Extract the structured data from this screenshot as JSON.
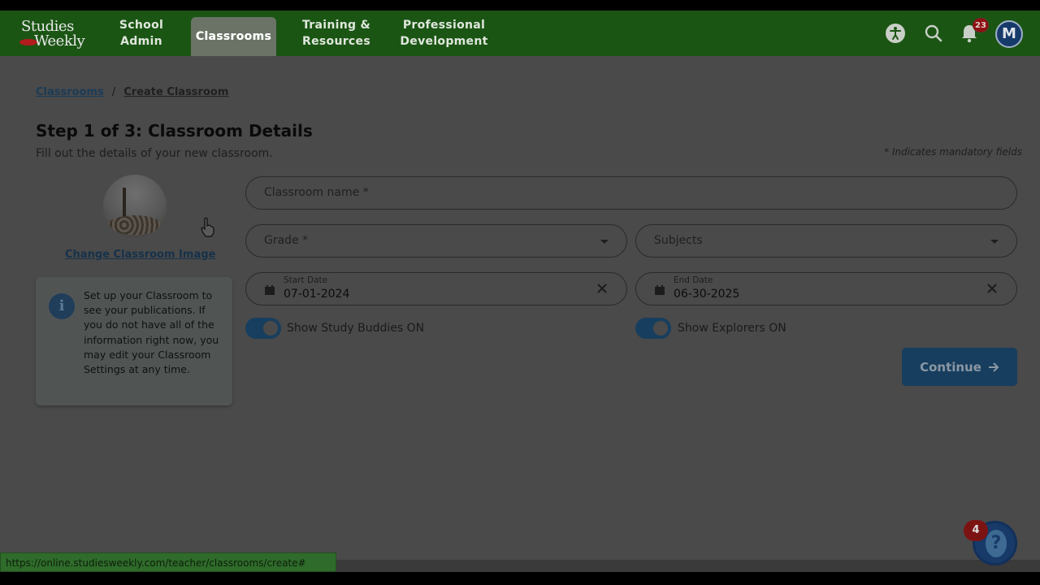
{
  "header": {
    "logo_line1": "Studies",
    "logo_line2": "Weekly",
    "nav": [
      {
        "label": "School\nAdmin"
      },
      {
        "label": "Classrooms"
      },
      {
        "label": "Training &\nResources"
      },
      {
        "label": "Professional\nDevelopment"
      }
    ],
    "active_nav": "Classrooms",
    "notification_count": "23",
    "avatar_initial": "M",
    "icons": [
      "accessibility-icon",
      "search-icon",
      "bell-icon"
    ]
  },
  "breadcrumb": {
    "root": "Classrooms",
    "separator": "/",
    "current": "Create Classroom"
  },
  "page": {
    "title": "Step 1 of 3: Classroom Details",
    "subtitle": "Fill out the details of your new classroom.",
    "mandatory_note": "* Indicates mandatory fields"
  },
  "image_panel": {
    "change_image_label": "Change Classroom Image",
    "info_text": "Set up your Classroom to see your publications. If you do not have all of the information right now, you may edit your Classroom Settings at any time."
  },
  "form": {
    "classroom_name_placeholder": "Classroom name *",
    "grade_placeholder": "Grade *",
    "subjects_placeholder": "Subjects",
    "start_date_label": "Start Date",
    "start_date_value": "07-01-2024",
    "end_date_label": "End Date",
    "end_date_value": "06-30-2025",
    "toggle_study_buddies": "Show Study Buddies ON",
    "toggle_explorers": "Show Explorers ON",
    "continue_label": "Continue"
  },
  "status_bar": {
    "url": "https://online.studiesweekly.com/teacher/classrooms/create#"
  },
  "help": {
    "badge_count": "4"
  },
  "colors": {
    "header_green": "#1b5514",
    "primary_blue": "#173e5e",
    "badge_red": "#8f1010"
  }
}
